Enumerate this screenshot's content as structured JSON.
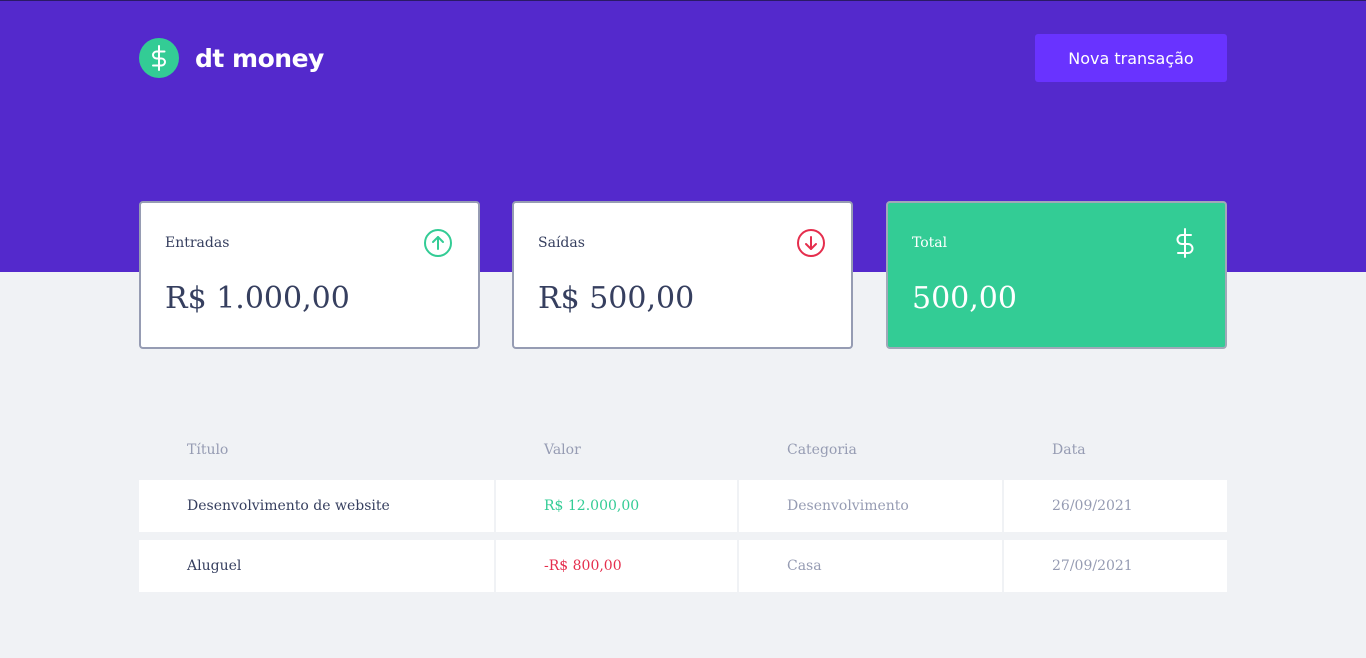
{
  "header": {
    "logo_text": "dt money",
    "new_transaction_label": "Nova transação"
  },
  "summary": {
    "income": {
      "label": "Entradas",
      "value": "R$ 1.000,00"
    },
    "outcome": {
      "label": "Saídas",
      "value": "R$ 500,00"
    },
    "total": {
      "label": "Total",
      "value": "500,00"
    }
  },
  "table": {
    "headers": [
      "Título",
      "Valor",
      "Categoria",
      "Data"
    ],
    "rows": [
      {
        "title": "Desenvolvimento de website",
        "amount": "R$ 12.000,00",
        "category": "Desenvolvimento",
        "date": "26/09/2021"
      },
      {
        "title": "Aluguel",
        "amount": "-R$ 800,00",
        "category": "Casa",
        "date": "27/09/2021"
      }
    ]
  },
  "icons": {
    "logo": "dollar-circle-icon",
    "income": "arrow-up-circle-icon",
    "outcome": "arrow-down-circle-icon",
    "total": "dollar-sign-icon"
  },
  "colors": {
    "header_bg": "#5429cc",
    "button_bg": "#6933ff",
    "green": "#33cc95",
    "red": "#e52e4d",
    "text": "#363f5f",
    "text_muted": "#969cb3",
    "background": "#f0f2f5"
  }
}
